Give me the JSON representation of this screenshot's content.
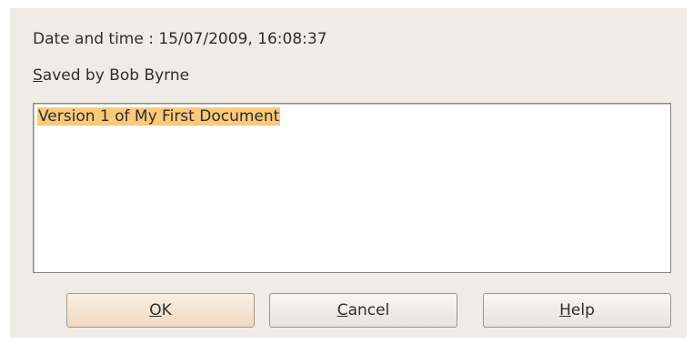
{
  "info": {
    "date_time": "Date and time : 15/07/2009, 16:08:37",
    "saved_by_mnemonic": "S",
    "saved_by_rest": "aved by Bob Byrne"
  },
  "comment": {
    "text": "Version 1 of My First Document",
    "selection_color": "#fbc97b"
  },
  "buttons": {
    "ok": {
      "mnemonic": "O",
      "rest": "K"
    },
    "cancel": {
      "mnemonic": "C",
      "rest": "ancel"
    },
    "help": {
      "mnemonic": "H",
      "rest": "elp"
    }
  }
}
